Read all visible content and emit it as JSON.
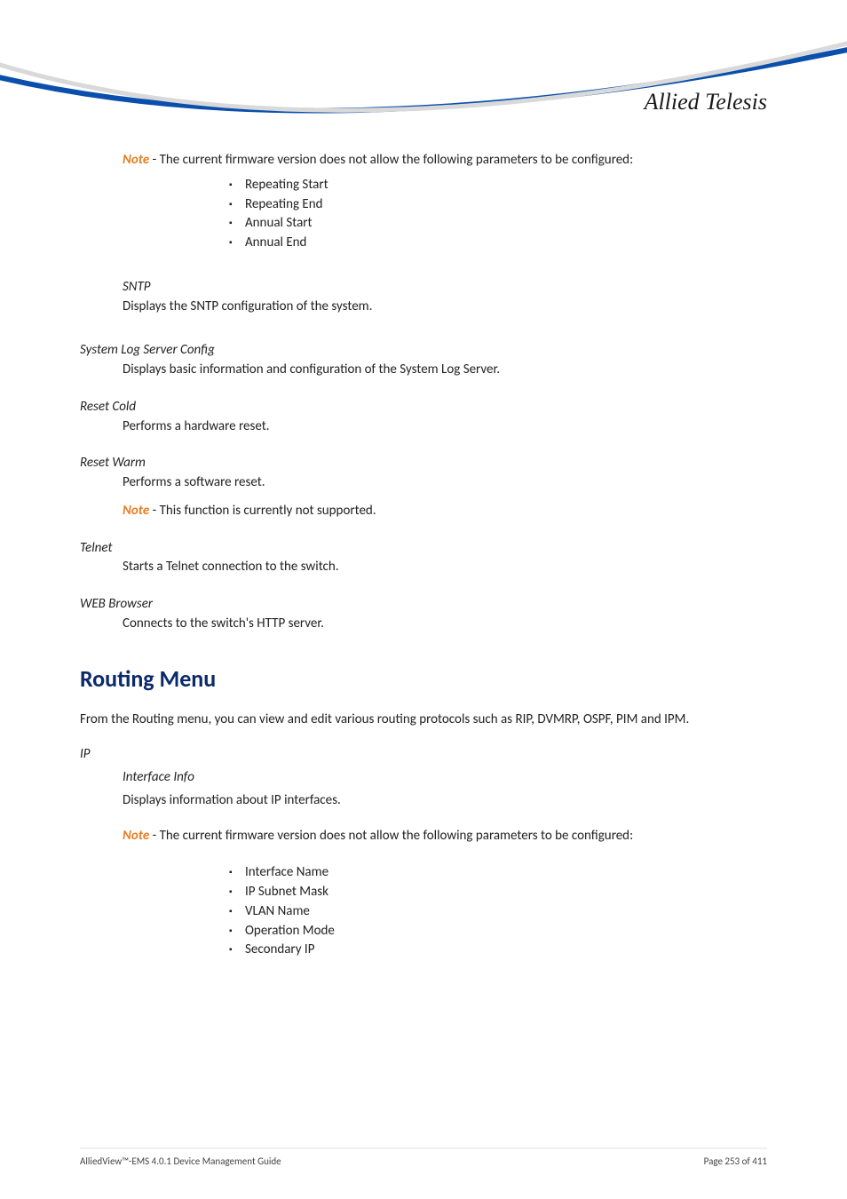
{
  "logo_text": "Allied Telesis",
  "note1_label": "Note",
  "note1_body": " - The current firmware version does not allow the following parameters to be configured:",
  "note1_bullets": [
    "Repeating Start",
    "Repeating End",
    "Annual Start",
    "Annual End"
  ],
  "sntp": {
    "term": "SNTP",
    "body": "Displays the SNTP configuration of the system."
  },
  "syslog": {
    "term": "System Log Server Config",
    "body": "Displays basic information and configuration of the System Log Server."
  },
  "resetcold": {
    "term": "Reset Cold",
    "body": "Performs a hardware reset."
  },
  "resetwarm": {
    "term": "Reset Warm",
    "body": "Performs a software reset.",
    "note_label": "Note",
    "note_body": " - This function is currently not supported."
  },
  "telnet": {
    "term": "Telnet",
    "body": "Starts a Telnet connection to the switch."
  },
  "web": {
    "term": "WEB Browser",
    "body": "Connects to the switch's HTTP server."
  },
  "routing_heading": "Routing Menu",
  "routing_intro": "From the Routing menu, you can view and edit various routing protocols such as RIP, DVMRP, OSPF, PIM and IPM.",
  "ip": {
    "term": "IP",
    "iface_term": "Interface Info",
    "iface_body": "Displays information about IP interfaces.",
    "note_label": "Note",
    "note_body": " - The current firmware version does not allow the following parameters to be configured:",
    "bullets": [
      "Interface Name",
      "IP Subnet Mask",
      "VLAN Name",
      "Operation Mode",
      "Secondary IP"
    ]
  },
  "footer_left": "AlliedView™-EMS 4.0.1 Device Management Guide",
  "footer_right": "Page 253 of 411"
}
